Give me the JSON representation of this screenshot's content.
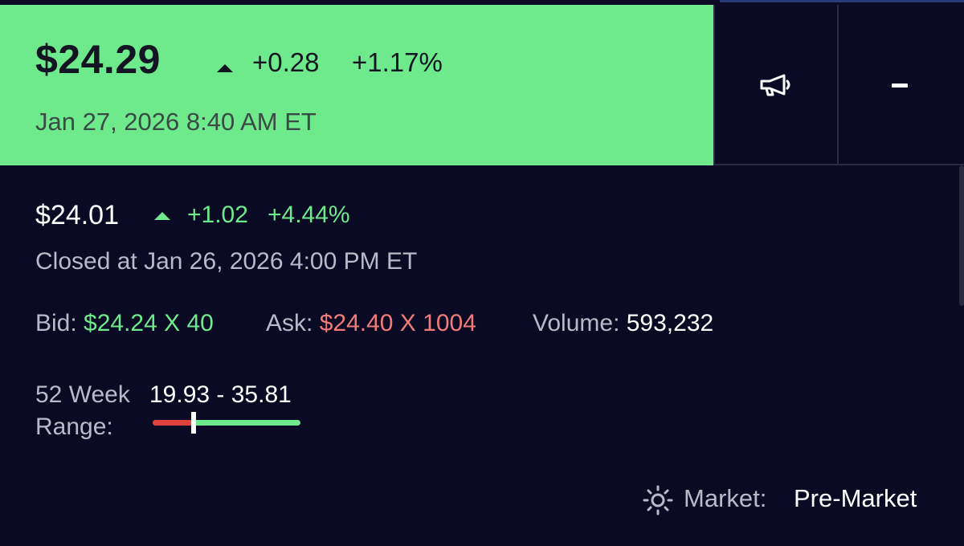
{
  "quote": {
    "price": "$24.29",
    "change": "+0.28",
    "change_pct": "+1.17%",
    "timestamp": "Jan 27, 2026 8:40 AM ET",
    "direction": "up",
    "banner_color": "#6ee98b"
  },
  "actions": {
    "announce_icon": "megaphone-icon",
    "minimize_label": "-"
  },
  "close": {
    "price": "$24.01",
    "change": "+1.02",
    "change_pct": "+4.44%",
    "direction": "up",
    "timestamp": "Closed at Jan 26, 2026 4:00 PM ET"
  },
  "bid": {
    "label": "Bid:",
    "value": "$24.24 X 40",
    "color": "#6ee98b"
  },
  "ask": {
    "label": "Ask:",
    "value": "$24.40 X 1004",
    "color": "#f07b78"
  },
  "volume": {
    "label": "Volume:",
    "value": "593,232"
  },
  "range52": {
    "label_line1": "52 Week",
    "label_line2": "Range:",
    "values": "19.93 - 35.81",
    "low": 19.93,
    "high": 35.81,
    "current": 24.29
  },
  "market": {
    "icon": "sun-icon",
    "label": "Market:",
    "value": "Pre-Market"
  }
}
